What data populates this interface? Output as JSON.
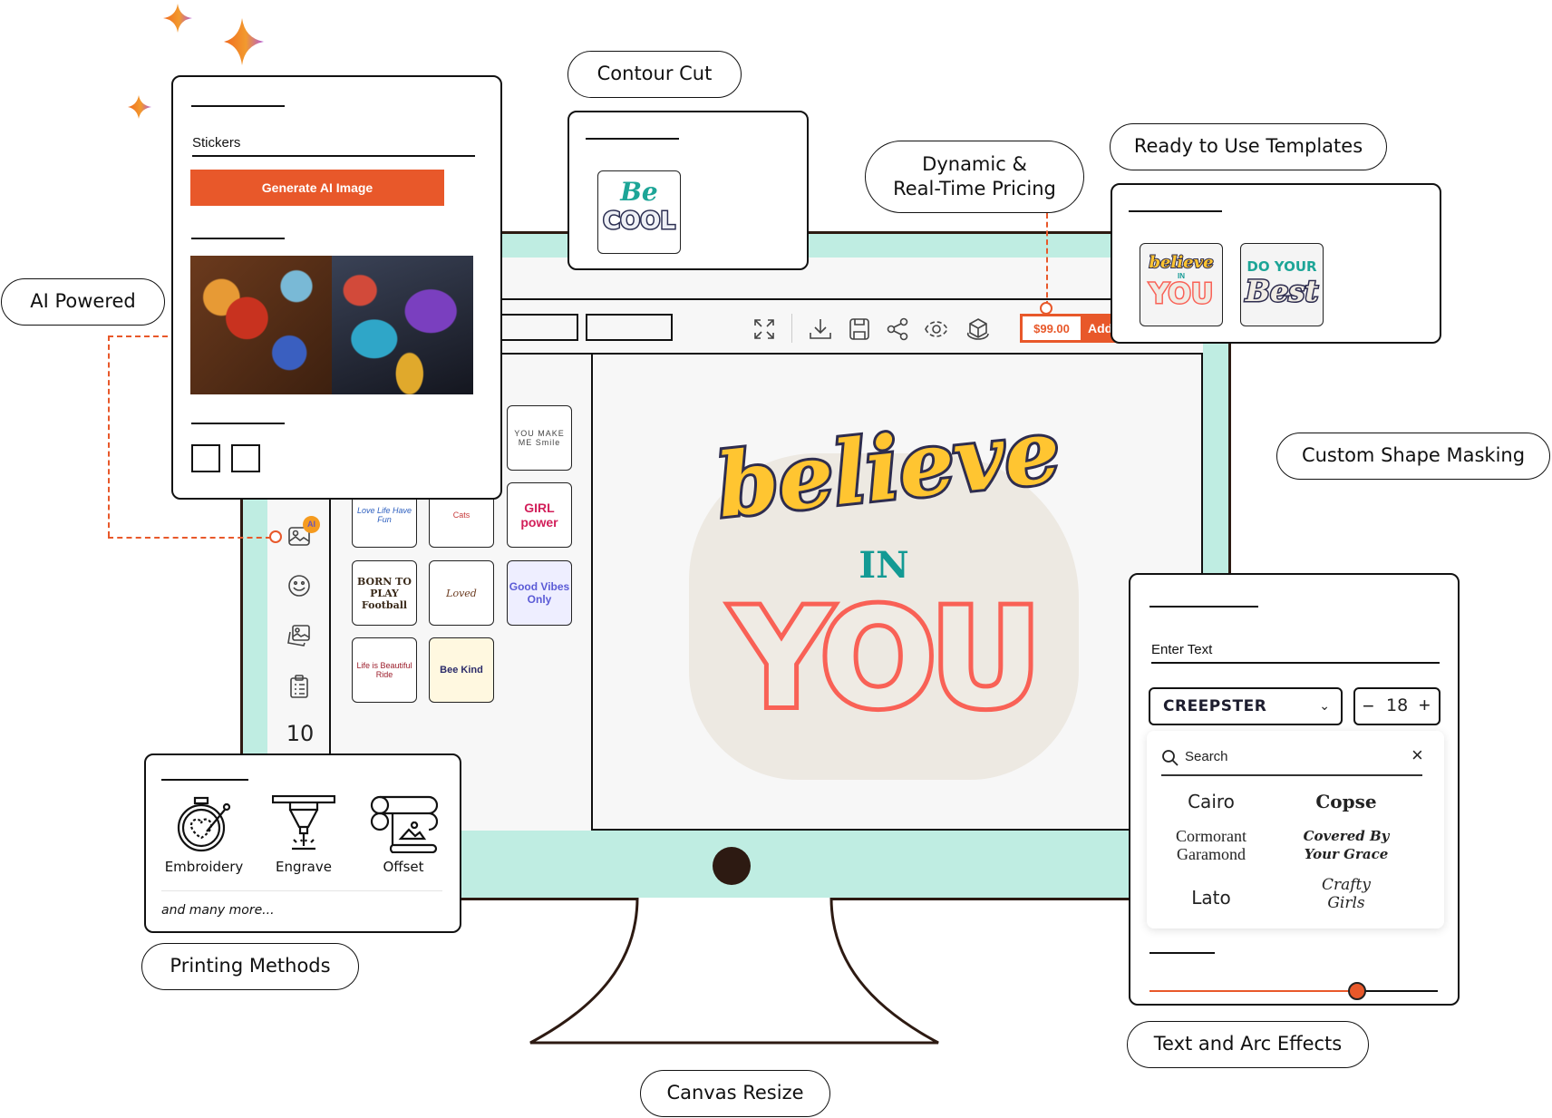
{
  "features": {
    "ai_powered": "AI Powered",
    "contour_cut": "Contour Cut",
    "dynamic_pricing_line1": "Dynamic &",
    "dynamic_pricing_line2": "Real-Time Pricing",
    "templates": "Ready to Use Templates",
    "custom_shape": "Custom Shape Masking",
    "printing_methods": "Printing Methods",
    "canvas_resize": "Canvas Resize",
    "text_arc": "Text and Arc Effects"
  },
  "ai_panel": {
    "prompt_value": "Stickers",
    "generate_label": "Generate AI Image"
  },
  "contour_panel": {
    "sticker_line1": "Be",
    "sticker_line2": "COOL"
  },
  "templates_panel": {
    "items": [
      {
        "line1": "believe",
        "line2": "IN",
        "line3": "YOU"
      },
      {
        "line1": "DO YOUR",
        "line2": "Best"
      }
    ]
  },
  "toolbar": {
    "price": "$99.00",
    "add_label": "Add",
    "icons": [
      "fullscreen-icon",
      "download-icon",
      "save-icon",
      "share-icon",
      "preview-icon",
      "3d-view-icon"
    ]
  },
  "sidebar": {
    "ai_badge": "AI",
    "counter": "10"
  },
  "gallery": {
    "items": [
      {
        "text": "YOU MAKE ME Smile"
      },
      {
        "text": "Love Life Have Fun"
      },
      {
        "text": "Cats"
      },
      {
        "text": "GIRL power"
      },
      {
        "text": "BORN TO PLAY Football"
      },
      {
        "text": "Loved"
      },
      {
        "text": "Good Vibes Only"
      },
      {
        "text": "Life is Beautiful Ride"
      },
      {
        "text": "Bee Kind"
      }
    ]
  },
  "canvas": {
    "line1": "believe",
    "line2": "IN",
    "line3": "YOU"
  },
  "printing_panel": {
    "methods": [
      {
        "label": "Embroidery",
        "icon": "embroidery-hoop-icon"
      },
      {
        "label": "Engrave",
        "icon": "laser-engrave-icon"
      },
      {
        "label": "Offset",
        "icon": "offset-print-icon"
      }
    ],
    "more": "and many more..."
  },
  "text_panel": {
    "text_placeholder": "Enter Text",
    "font_selected": "CREEPSTER",
    "font_size": "18",
    "search_placeholder": "Search",
    "fonts": [
      "Cairo",
      "Copse",
      "Cormorant Garamond",
      "Covered By Your Grace",
      "Lato",
      "Crafty Girls"
    ],
    "arc_value": 0.72
  },
  "colors": {
    "accent": "#e8582a",
    "bezel": "#bfede2",
    "frame": "#2d1a12"
  }
}
